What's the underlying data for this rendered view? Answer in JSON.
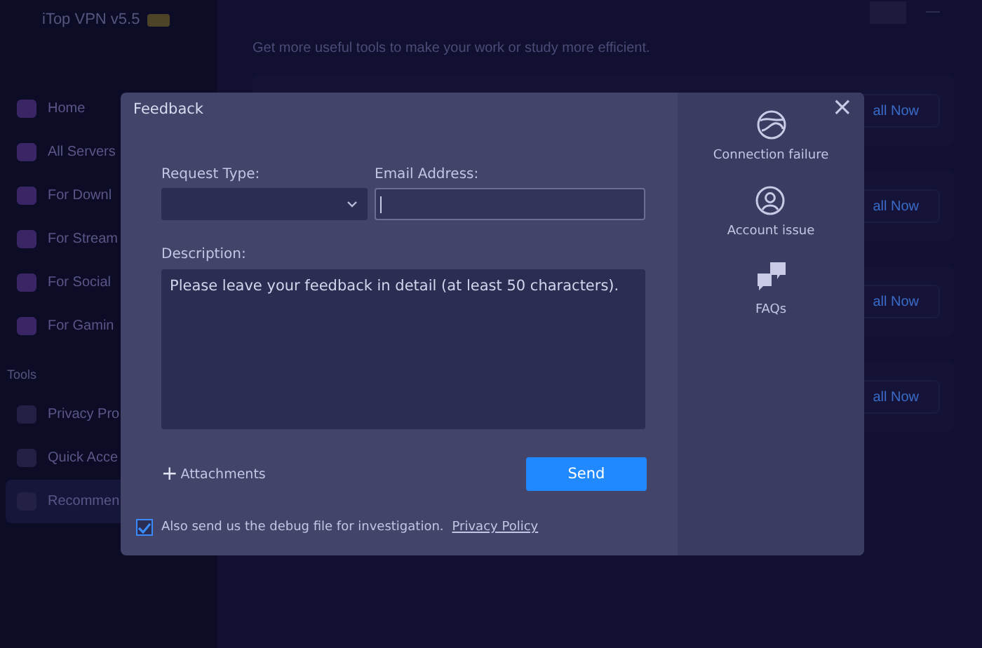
{
  "app": {
    "title": "iTop VPN v5.5"
  },
  "sidebar": {
    "items": [
      {
        "label": "Home",
        "selected": false
      },
      {
        "label": "All Servers",
        "selected": false
      },
      {
        "label": "For Downl",
        "selected": false
      },
      {
        "label": "For Stream",
        "selected": false
      },
      {
        "label": "For Social",
        "selected": false
      },
      {
        "label": "For Gamin",
        "selected": false
      }
    ],
    "section_title": "Tools",
    "tools": [
      {
        "label": "Privacy Pro",
        "selected": false
      },
      {
        "label": "Quick Acce",
        "selected": false
      },
      {
        "label": "Recommen",
        "selected": true
      }
    ]
  },
  "main": {
    "subtitle": "Get more useful tools to make your work or study more efficient.",
    "cards": [
      {
        "button": "all Now"
      },
      {
        "button": "all Now"
      },
      {
        "button": "all Now"
      },
      {
        "button": "all Now"
      }
    ]
  },
  "dialog": {
    "title": "Feedback",
    "close": "×",
    "request_type": {
      "label": "Request Type:"
    },
    "email": {
      "label": "Email Address:"
    },
    "description": {
      "label": "Description:",
      "placeholder": "Please leave your feedback in detail (at least 50 characters)."
    },
    "attachments": {
      "icon": "+",
      "label": "Attachments"
    },
    "send": "Send",
    "debug": {
      "label": "Also send us the debug file for investigation.",
      "checked": true,
      "link": "Privacy Policy"
    },
    "help": [
      {
        "label": "Connection failure"
      },
      {
        "label": "Account issue"
      },
      {
        "label": "FAQs"
      }
    ]
  }
}
